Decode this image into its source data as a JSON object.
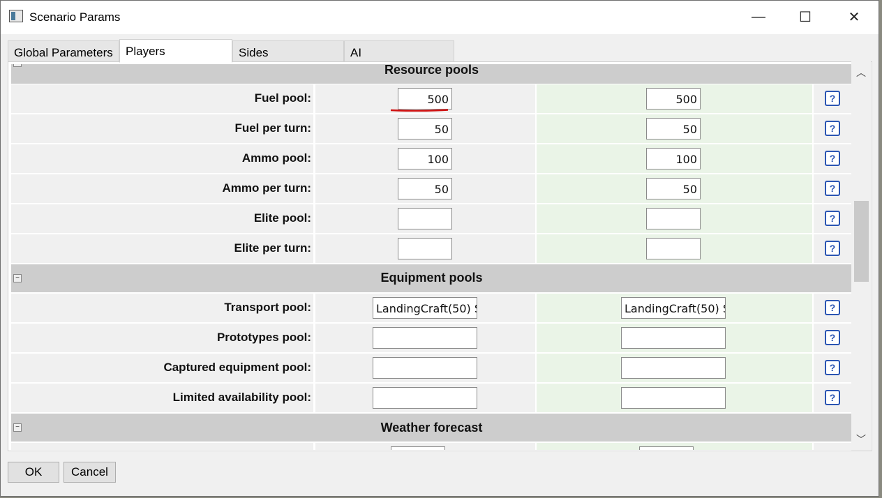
{
  "window": {
    "title": "Scenario Params"
  },
  "titlebar_controls": {
    "minimize": "—",
    "maximize": "☐",
    "close": "✕"
  },
  "tabs": [
    {
      "label": "Global Parameters",
      "active": false
    },
    {
      "label": "Players",
      "active": true
    },
    {
      "label": "Sides",
      "active": false
    },
    {
      "label": "AI",
      "active": false
    }
  ],
  "sections": {
    "resource": {
      "title": "Resource pools",
      "collapse": "−"
    },
    "equipment": {
      "title": "Equipment pools",
      "collapse": "−"
    },
    "weather": {
      "title": "Weather forecast",
      "collapse": "−"
    }
  },
  "resource_rows": [
    {
      "label": "Fuel pool:",
      "p1": "500",
      "p2": "500"
    },
    {
      "label": "Fuel per turn:",
      "p1": "50",
      "p2": "50"
    },
    {
      "label": "Ammo pool:",
      "p1": "100",
      "p2": "100"
    },
    {
      "label": "Ammo per turn:",
      "p1": "50",
      "p2": "50"
    },
    {
      "label": "Elite pool:",
      "p1": "",
      "p2": ""
    },
    {
      "label": "Elite per turn:",
      "p1": "",
      "p2": ""
    }
  ],
  "equipment_rows": [
    {
      "label": "Transport pool:",
      "p1": "LandingCraft(50) S",
      "p2": "LandingCraft(50) S"
    },
    {
      "label": "Prototypes pool:",
      "p1": "",
      "p2": ""
    },
    {
      "label": "Captured equipment pool:",
      "p1": "",
      "p2": ""
    },
    {
      "label": "Limited availability pool:",
      "p1": "",
      "p2": ""
    }
  ],
  "help": {
    "glyph": "?"
  },
  "scroll": {
    "up": "︿",
    "down": "﹀"
  },
  "buttons": {
    "ok": "OK",
    "cancel": "Cancel"
  },
  "colors": {
    "help_blue": "#2b55b3",
    "player2_bg": "#eaf4e7",
    "header_bg": "#cdcdcd",
    "underline_red": "#d01010"
  }
}
